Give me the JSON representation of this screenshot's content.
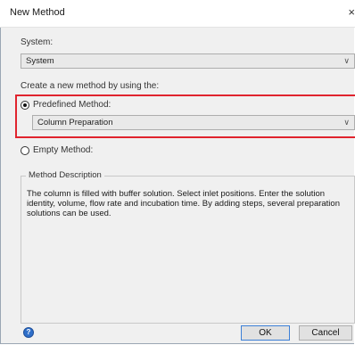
{
  "window": {
    "title": "New Method",
    "close_glyph": "×"
  },
  "system": {
    "label": "System:",
    "selected": "System"
  },
  "create_label": "Create a new method by using the:",
  "predefined": {
    "label": "Predefined Method:",
    "checked": true,
    "selected": "Column Preparation"
  },
  "empty": {
    "label": "Empty Method:",
    "checked": false
  },
  "description": {
    "legend": "Method Description",
    "text": "The column is filled with buffer solution. Select inlet positions. Enter the solution identity, volume, flow rate and incubation time. By adding steps, several preparation solutions can be used."
  },
  "buttons": {
    "ok": "OK",
    "cancel": "Cancel",
    "help_glyph": "?"
  },
  "colors": {
    "highlight": "#e0242e",
    "ok_border": "#3c7fd6"
  },
  "icons": {
    "dropdown": "chevron-down-icon",
    "help": "help-icon",
    "close": "close-icon"
  }
}
